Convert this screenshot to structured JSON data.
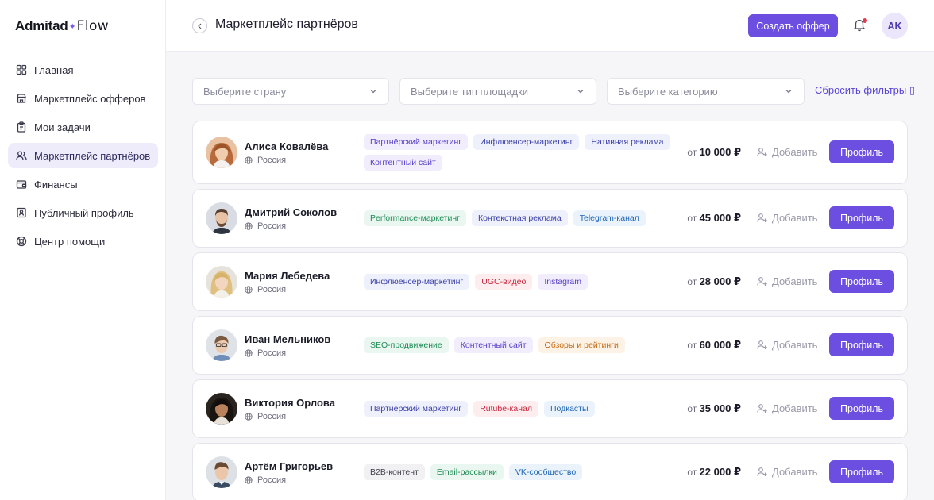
{
  "app": {
    "logo": {
      "brand": "Admitad",
      "spark": "✦",
      "product": "Flow"
    }
  },
  "sidebar": {
    "items": [
      {
        "label": "Главная",
        "icon": "grid-icon",
        "active": false
      },
      {
        "label": "Маркетплейс офферов",
        "icon": "store-icon",
        "active": false
      },
      {
        "label": "Мои задачи",
        "icon": "clipboard-icon",
        "active": false
      },
      {
        "label": "Маркетплейс партнёров",
        "icon": "users-icon",
        "active": true
      },
      {
        "label": "Финансы",
        "icon": "wallet-icon",
        "active": false
      },
      {
        "label": "Публичный профиль",
        "icon": "id-card-icon",
        "active": false
      },
      {
        "label": "Центр помощи",
        "icon": "lifebuoy-icon",
        "active": false
      }
    ]
  },
  "header": {
    "title": "Маркетплейс партнёров",
    "create_label": "Создать оффер",
    "avatar_initials": "AK",
    "has_notification": true
  },
  "filters": {
    "country_placeholder": "Выберите страну",
    "platform_placeholder": "Выберите тип площадки",
    "category_placeholder": "Выберите категорию",
    "reset_label": "Сбросить фильтры ▯"
  },
  "labels": {
    "price_prefix": "от",
    "add": "Добавить",
    "profile": "Профиль"
  },
  "partners": [
    {
      "name": "Алиса Ковалёва",
      "country": "Россия",
      "price": "10 000 ₽",
      "tags": [
        {
          "label": "Партнёрский маркетинг",
          "color": "violet"
        },
        {
          "label": "Инфлюенсер-маркетинг",
          "color": "indigo"
        },
        {
          "label": "Нативная реклама",
          "color": "indigo"
        },
        {
          "label": "Контентный сайт",
          "color": "violet"
        }
      ]
    },
    {
      "name": "Дмитрий Соколов",
      "country": "Россия",
      "price": "45 000 ₽",
      "tags": [
        {
          "label": "Performance-маркетинг",
          "color": "green"
        },
        {
          "label": "Контекстная реклама",
          "color": "indigo"
        },
        {
          "label": "Telegram-канал",
          "color": "blue"
        }
      ]
    },
    {
      "name": "Мария Лебедева",
      "country": "Россия",
      "price": "28 000 ₽",
      "tags": [
        {
          "label": "Инфлюенсер-маркетинг",
          "color": "indigo"
        },
        {
          "label": "UGC-видео",
          "color": "red"
        },
        {
          "label": "Instagram",
          "color": "violet"
        }
      ]
    },
    {
      "name": "Иван Мельников",
      "country": "Россия",
      "price": "60 000 ₽",
      "tags": [
        {
          "label": "SEO-продвижение",
          "color": "green"
        },
        {
          "label": "Контентный сайт",
          "color": "violet"
        },
        {
          "label": "Обзоры и рейтинги",
          "color": "orange"
        }
      ]
    },
    {
      "name": "Виктория Орлова",
      "country": "Россия",
      "price": "35 000 ₽",
      "tags": [
        {
          "label": "Партнёрский маркетинг",
          "color": "indigo"
        },
        {
          "label": "Rutube-канал",
          "color": "red"
        },
        {
          "label": "Подкасты",
          "color": "blue"
        }
      ]
    },
    {
      "name": "Артём Григорьев",
      "country": "Россия",
      "price": "22 000 ₽",
      "tags": [
        {
          "label": "B2B-контент",
          "color": "gray"
        },
        {
          "label": "Email-рассылки",
          "color": "green"
        },
        {
          "label": "VK-сообщество",
          "color": "blue"
        }
      ]
    }
  ],
  "colors": {
    "accent": "#6c4fe0",
    "active_nav_bg": "#eeecfb",
    "notification_dot": "#e53950"
  }
}
